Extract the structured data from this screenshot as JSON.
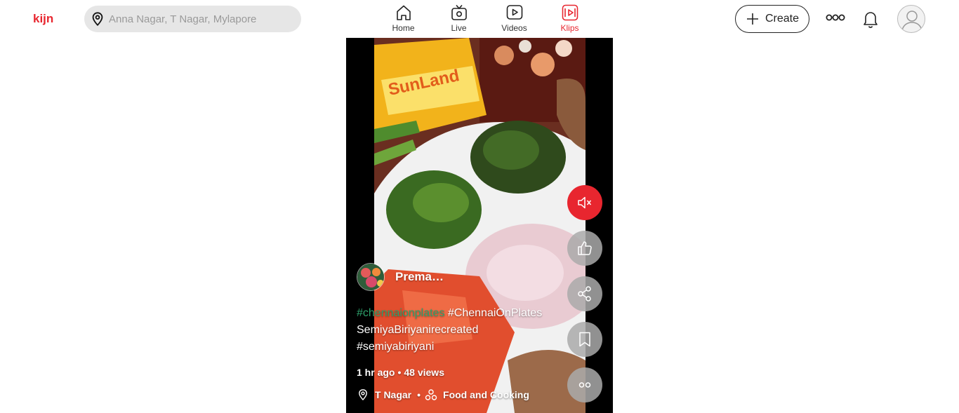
{
  "brand": {
    "logo_text": "kijn",
    "accent": "#e8262f"
  },
  "search": {
    "placeholder": "Anna Nagar, T Nagar, Mylapore",
    "icon": "location-pin-icon"
  },
  "nav": {
    "items": [
      {
        "label": "Home",
        "icon": "home-icon",
        "active": false
      },
      {
        "label": "Live",
        "icon": "tv-icon",
        "active": false
      },
      {
        "label": "Videos",
        "icon": "play-icon",
        "active": false
      },
      {
        "label": "Klips",
        "icon": "klips-icon",
        "active": true
      }
    ]
  },
  "header": {
    "create_label": "Create"
  },
  "klip": {
    "author": "Prema…",
    "caption": {
      "tag1": "#chennaionplates",
      "tag2": "#ChennaiOnPlates",
      "line2": "SemiyaBiriyanirecreated",
      "line3": "#semiyabiriyani"
    },
    "time": "1 hr ago",
    "views": "48 views",
    "location": "T Nagar",
    "category": "Food and Cooking",
    "actions": [
      "mute-icon",
      "like-icon",
      "share-icon",
      "bookmark-icon",
      "more-icon"
    ]
  }
}
